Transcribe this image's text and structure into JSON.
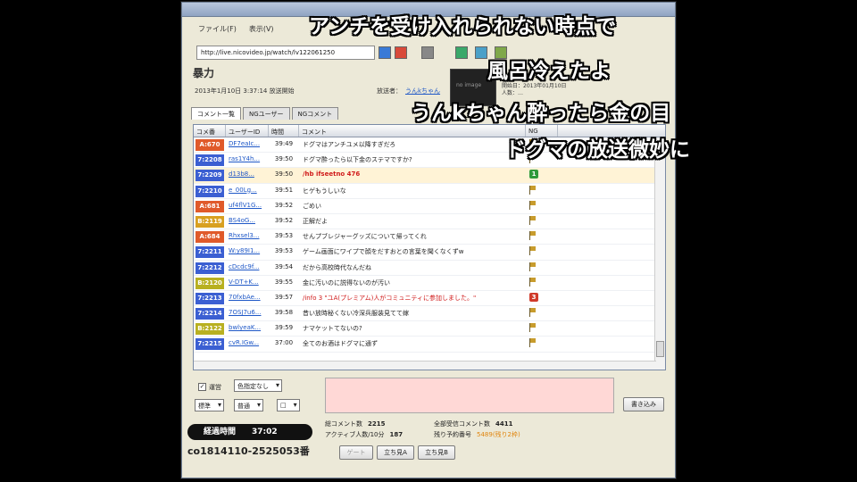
{
  "window": {
    "menus": [
      "ファイル(F)",
      "表示(V)"
    ],
    "url": "http://live.nicovideo.jp/watch/lv122061250",
    "title": "暴力",
    "info_line": "2013年1月10日 3:37:14 放送開始",
    "caster_label": "放送者：",
    "caster_name": "うんkちゃん",
    "start_info": [
      "開始日：2013年01月10日",
      "人数：…"
    ],
    "thumb_text": "no image"
  },
  "tabs": [
    "コメント一覧",
    "NGユーザー",
    "NGコメント"
  ],
  "table": {
    "headers": [
      "コメ番",
      "ユーザーID",
      "時間",
      "コメント",
      "NG"
    ],
    "rows": [
      {
        "no": "A:670",
        "color": "#e05a2a",
        "user": "DF7eaIc...",
        "time": "39:49",
        "comment": "ドグマはアンチユメ以降すぎだろ",
        "style": "",
        "ng": "flag"
      },
      {
        "no": "7:2208",
        "color": "#3b5fd2",
        "user": "ras1Y4h...",
        "time": "39:50",
        "comment": "ドグマ酔ったら以下金のステマですか?",
        "style": "",
        "ng": "flag"
      },
      {
        "no": "7:2209",
        "color": "#3b5fd2",
        "user": "d13b8...",
        "time": "39:50",
        "comment": "/hb ifseetno 476",
        "style": "cmd",
        "ng": "green"
      },
      {
        "no": "7:2210",
        "color": "#3b5fd2",
        "user": "e_00Lg...",
        "time": "39:51",
        "comment": "ヒゲもうしいな",
        "style": "",
        "ng": "flag"
      },
      {
        "no": "A:681",
        "color": "#e05a2a",
        "user": "uf4flV1G...",
        "time": "39:52",
        "comment": "ごめい",
        "style": "",
        "ng": "flag"
      },
      {
        "no": "B:2119",
        "color": "#d8a020",
        "user": "BS4oG...",
        "time": "39:52",
        "comment": "正解だよ",
        "style": "",
        "ng": "flag"
      },
      {
        "no": "A:684",
        "color": "#e05a2a",
        "user": "Rhxsel3...",
        "time": "39:53",
        "comment": "せんプブレジャーグッズについて帰ってくれ",
        "style": "",
        "ng": "flag"
      },
      {
        "no": "7:2211",
        "color": "#3b5fd2",
        "user": "W:y89I1...",
        "time": "39:53",
        "comment": "ゲーム画面にワイプで顔をだすおとの言葉を聞くなくずw",
        "style": "",
        "ng": "flag"
      },
      {
        "no": "7:2212",
        "color": "#3b5fd2",
        "user": "cDcdc9f...",
        "time": "39:54",
        "comment": "だから高校時代なんだね",
        "style": "",
        "ng": "flag"
      },
      {
        "no": "B:2120",
        "color": "#b8b020",
        "user": "V-DT+K...",
        "time": "39:55",
        "comment": "金に汚いのに説得ないのが汚い",
        "style": "",
        "ng": "flag"
      },
      {
        "no": "7:2213",
        "color": "#3b5fd2",
        "user": "70fxbAe...",
        "time": "39:57",
        "comment": "/info 3 \"ユA(プレミアム)人がコミュニティに参加しました。\"",
        "style": "red",
        "ng": "red"
      },
      {
        "no": "7:2214",
        "color": "#3b5fd2",
        "user": "7OSJ7u6...",
        "time": "39:58",
        "comment": "昔い放時秘くない冷深兵服装見てて嫁",
        "style": "",
        "ng": "flag"
      },
      {
        "no": "B:2122",
        "color": "#b8b020",
        "user": "bwlyeaK...",
        "time": "39:59",
        "comment": "ナマケットてないの?",
        "style": "",
        "ng": "flag"
      },
      {
        "no": "7:2215",
        "color": "#3b5fd2",
        "user": "cvR.IGw...",
        "time": "37:00",
        "comment": "全てのお酒はドグマに通ず",
        "style": "",
        "ng": "flag"
      }
    ]
  },
  "controls": {
    "unei_label": "運営",
    "mail_select": "色指定なし",
    "size_select": "標準",
    "pos_select": "普通",
    "anon_select": "□",
    "submit": "書き込み"
  },
  "stats": {
    "total_label": "総コメント数",
    "total_value": "2215",
    "active_label": "アクティブ人数/10分",
    "active_value": "187",
    "all_label": "全部受信コメント数",
    "all_value": "4411",
    "remain_label": "残り予約番号",
    "remain_value": "5489(残り2枠)"
  },
  "bottom_buttons": [
    "ゲート",
    "立ち見A",
    "立ち見B"
  ],
  "elapsed": {
    "label": "経過時間",
    "value": "37:02"
  },
  "community_id": "co1814110-2525053番",
  "overlays": [
    "アンチを受け入れられない時点で",
    "風呂冷えたよ",
    "うんkちゃん酔ったら金の目",
    "ドグマの放送微妙に"
  ]
}
